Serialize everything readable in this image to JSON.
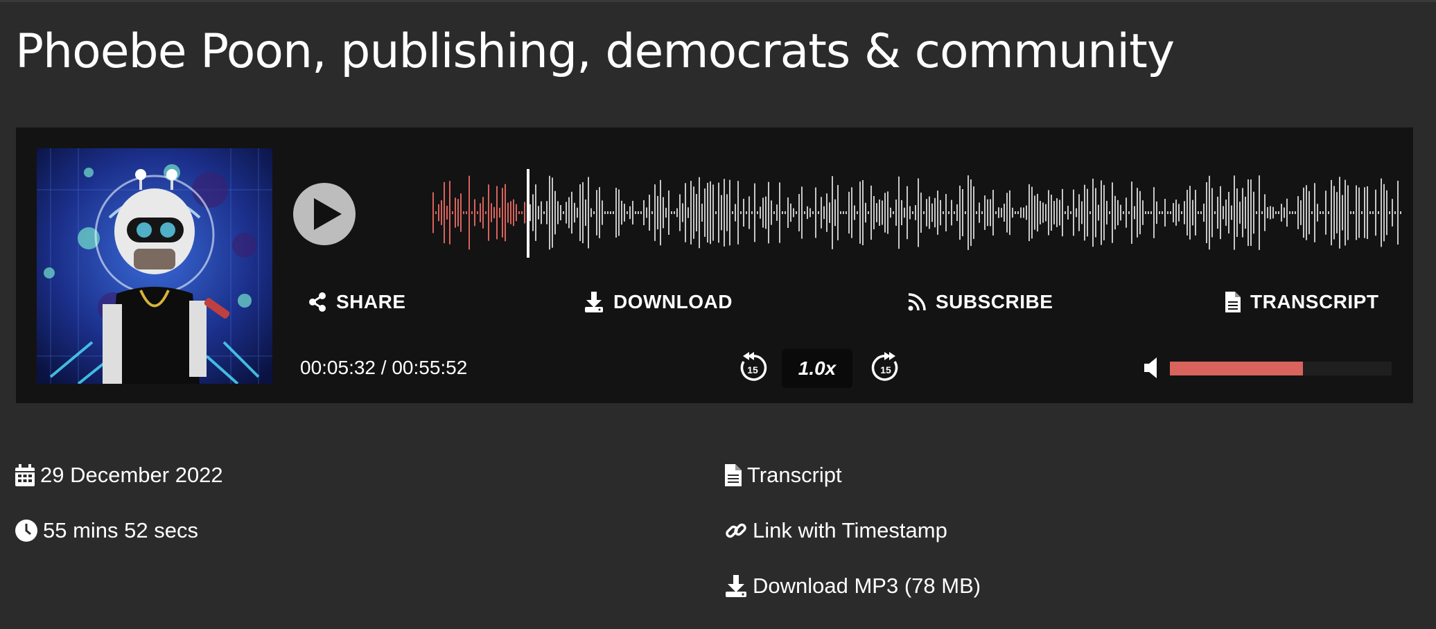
{
  "episode": {
    "title": "Phoebe Poon, publishing, democrats & community",
    "cover_icon": "podcast-cover-robot-art"
  },
  "player": {
    "play_icon": "play-icon",
    "actions": {
      "share": "SHARE",
      "download": "DOWNLOAD",
      "subscribe": "SUBSCRIBE",
      "transcript": "TRANSCRIPT"
    },
    "time_display": "00:05:32 / 00:55:52",
    "current_time": "00:05:32",
    "duration": "00:55:52",
    "progress_fraction": 0.099,
    "skip_back_seconds": "15",
    "skip_forward_seconds": "15",
    "speed": "1.0x",
    "volume_fraction": 0.6,
    "colors": {
      "played": "#d9635d",
      "unplayed": "#c8c8c8",
      "panel": "#131313",
      "page": "#2b2b2b"
    }
  },
  "details": {
    "date": "29 December 2022",
    "length": "55 mins 52 secs",
    "transcript_link": "Transcript",
    "timestamp_link": "Link with Timestamp",
    "download_link": "Download MP3 (78 MB)"
  }
}
